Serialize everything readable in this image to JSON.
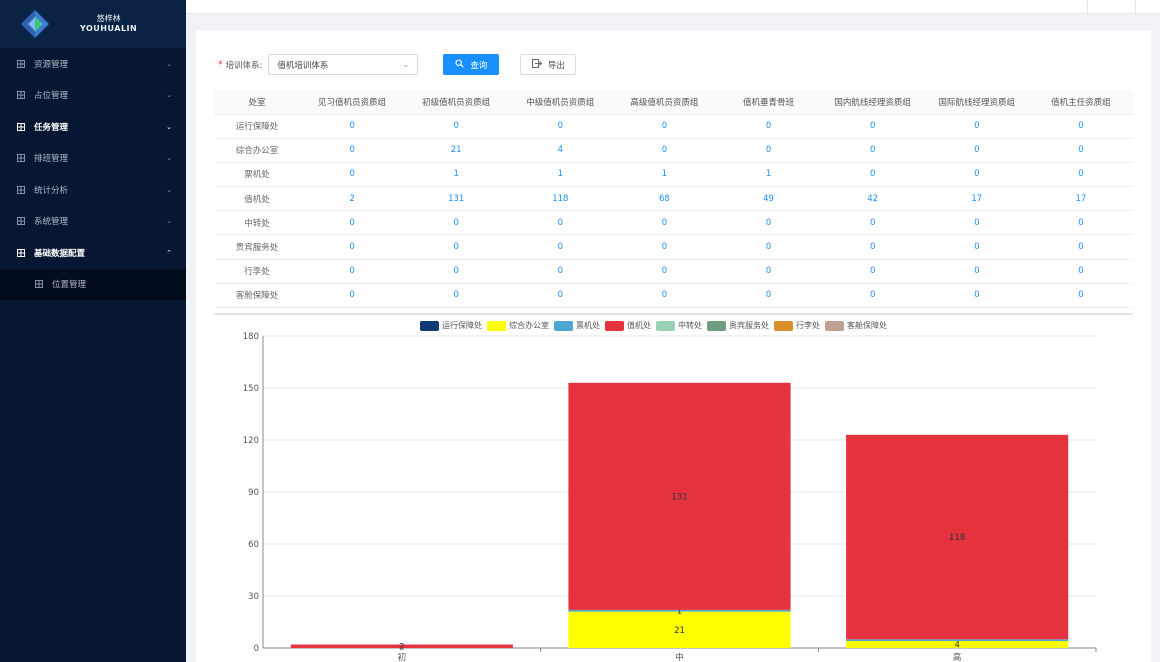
{
  "app": {
    "logo_name": "悠梓林",
    "logo_sub": "YOUHUALIN"
  },
  "sidebar": {
    "items": [
      {
        "label": "资源管理",
        "expanded": false
      },
      {
        "label": "占位管理",
        "expanded": false
      },
      {
        "label": "任务管理",
        "expanded": false
      },
      {
        "label": "排班管理",
        "expanded": false
      },
      {
        "label": "统计分析",
        "expanded": false
      },
      {
        "label": "系统管理",
        "expanded": false
      },
      {
        "label": "基础数据配置",
        "expanded": true
      }
    ],
    "subitems": [
      {
        "label": "位置管理"
      }
    ]
  },
  "toolbar": {
    "field_label": "培训体系:",
    "select_value": "值机培训体系",
    "query_label": "查询",
    "export_label": "导出"
  },
  "table": {
    "headers": [
      "处室",
      "见习值机员资质组",
      "初级值机员资质组",
      "中级值机员资质组",
      "高级值机员资质组",
      "值机垂青骨班",
      "国内航线经理资质组",
      "国际航线经理资质组",
      "值机主任资质组"
    ],
    "rows": [
      {
        "name": "运行保障处",
        "values": [
          "0",
          "0",
          "0",
          "0",
          "0",
          "0",
          "0",
          "0"
        ]
      },
      {
        "name": "综合办公室",
        "values": [
          "0",
          "21",
          "4",
          "0",
          "0",
          "0",
          "0",
          "0"
        ]
      },
      {
        "name": "票机处",
        "values": [
          "0",
          "1",
          "1",
          "1",
          "1",
          "0",
          "0",
          "0"
        ]
      },
      {
        "name": "值机处",
        "values": [
          "2",
          "131",
          "118",
          "68",
          "49",
          "42",
          "17",
          "17"
        ]
      },
      {
        "name": "中转处",
        "values": [
          "0",
          "0",
          "0",
          "0",
          "0",
          "0",
          "0",
          "0"
        ]
      },
      {
        "name": "贵宾服务处",
        "values": [
          "0",
          "0",
          "0",
          "0",
          "0",
          "0",
          "0",
          "0"
        ]
      },
      {
        "name": "行李处",
        "values": [
          "0",
          "0",
          "0",
          "0",
          "0",
          "0",
          "0",
          "0"
        ]
      },
      {
        "name": "客舱保障处",
        "values": [
          "0",
          "0",
          "0",
          "0",
          "0",
          "0",
          "0",
          "0"
        ]
      }
    ]
  },
  "chart_data": {
    "type": "bar",
    "stacked": true,
    "categories": [
      "初",
      "中",
      "高"
    ],
    "ylim": [
      0,
      180
    ],
    "yticks": [
      0,
      30,
      60,
      90,
      120,
      150,
      180
    ],
    "series": [
      {
        "name": "运行保障处",
        "color": "#0d3a73",
        "values": [
          0,
          0,
          0
        ]
      },
      {
        "name": "综合办公室",
        "color": "#ffff00",
        "values": [
          0,
          21,
          4
        ]
      },
      {
        "name": "票机处",
        "color": "#4ea7d0",
        "values": [
          0,
          1,
          1
        ]
      },
      {
        "name": "值机处",
        "color": "#e4323e",
        "values": [
          2,
          131,
          118
        ]
      },
      {
        "name": "中转处",
        "color": "#98d2b3",
        "values": [
          0,
          0,
          0
        ]
      },
      {
        "name": "贵宾服务处",
        "color": "#6f9b7e",
        "values": [
          0,
          0,
          0
        ]
      },
      {
        "name": "行李处",
        "color": "#d9902a",
        "values": [
          0,
          0,
          0
        ]
      },
      {
        "name": "客舱保障处",
        "color": "#c1a094",
        "values": [
          0,
          0,
          0
        ]
      }
    ],
    "bar_labels": [
      {
        "category": 0,
        "series": "值机处",
        "text": "2"
      },
      {
        "category": 1,
        "series": "综合办公室",
        "text": "21"
      },
      {
        "category": 1,
        "series": "票机处",
        "text": "1"
      },
      {
        "category": 1,
        "series": "值机处",
        "text": "131"
      },
      {
        "category": 2,
        "series": "综合办公室",
        "text": "4"
      },
      {
        "category": 2,
        "series": "值机处",
        "text": "118"
      }
    ]
  }
}
